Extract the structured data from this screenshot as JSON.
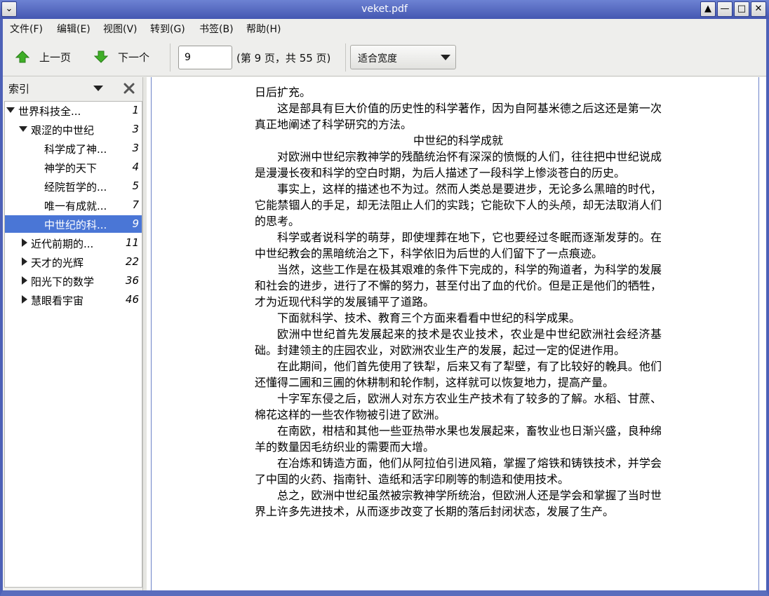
{
  "window": {
    "title": "veket.pdf"
  },
  "menu": [
    "文件(F)",
    "编辑(E)",
    "视图(V)",
    "转到(G)",
    "书签(B)",
    "帮助(H)"
  ],
  "toolbar": {
    "prev_label": "上一页",
    "next_label": "下一个",
    "page_value": "9",
    "page_count": "(第 9 页，共 55 页)",
    "zoom_value": "适合宽度"
  },
  "sidebar": {
    "title": "索引",
    "items": [
      {
        "label": "世界科技全...",
        "page": "1",
        "level": 0,
        "state": "open"
      },
      {
        "label": "艰涩的中世纪",
        "page": "3",
        "level": 1,
        "state": "open"
      },
      {
        "label": "科学成了神...",
        "page": "3",
        "level": 2,
        "state": "leaf"
      },
      {
        "label": "神学的天下",
        "page": "4",
        "level": 2,
        "state": "leaf"
      },
      {
        "label": "经院哲学的...",
        "page": "5",
        "level": 2,
        "state": "leaf"
      },
      {
        "label": "唯一有成就...",
        "page": "7",
        "level": 2,
        "state": "leaf"
      },
      {
        "label": "中世纪的科...",
        "page": "9",
        "level": 2,
        "state": "leaf",
        "selected": true
      },
      {
        "label": "近代前期的...",
        "page": "11",
        "level": 1,
        "state": "closed"
      },
      {
        "label": "天才的光辉",
        "page": "22",
        "level": 1,
        "state": "closed"
      },
      {
        "label": "阳光下的数学",
        "page": "36",
        "level": 1,
        "state": "closed"
      },
      {
        "label": "慧眼看宇宙",
        "page": "46",
        "level": 1,
        "state": "closed"
      }
    ]
  },
  "document": {
    "paragraphs": [
      {
        "text": "日后扩充。",
        "indent": false
      },
      {
        "text": "这是部具有巨大价值的历史性的科学著作，因为自阿基米德之后这还是第一次真正地阐述了科学研究的方法。",
        "indent": true
      },
      {
        "text": "中世纪的科学成就",
        "heading": true
      },
      {
        "text": "对欧洲中世纪宗教神学的残酷统治怀有深深的愤慨的人们，往往把中世纪说成是漫漫长夜和科学的空白时期，为后人描述了一段科学上惨淡苍白的历史。",
        "indent": true
      },
      {
        "text": "事实上，这样的描述也不为过。然而人类总是要进步，无论多么黑暗的时代，它能禁锢人的手足，却无法阻止人们的实践；它能砍下人的头颅，却无法取消人们的思考。",
        "indent": true
      },
      {
        "text": "科学或者说科学的萌芽，即使埋葬在地下，它也要经过冬眠而逐渐发芽的。在中世纪教会的黑暗统治之下，科学依旧为后世的人们留下了一点痕迹。",
        "indent": true
      },
      {
        "text": "当然，这些工作是在极其艰难的条件下完成的，科学的殉道者，为科学的发展和社会的进步，进行了不懈的努力，甚至付出了血的代价。但是正是他们的牺牲，才为近现代科学的发展铺平了道路。",
        "indent": true
      },
      {
        "text": "下面就科学、技术、教育三个方面来看看中世纪的科学成果。",
        "indent": true
      },
      {
        "text": "欧洲中世纪首先发展起来的技术是农业技术，农业是中世纪欧洲社会经济基础。封建领主的庄园农业，对欧洲农业生产的发展，起过一定的促进作用。",
        "indent": true
      },
      {
        "text": "在此期间，他们首先使用了铁犁，后来又有了犁壁，有了比较好的輓具。他们还懂得二圃和三圃的休耕制和轮作制，这样就可以恢复地力，提高产量。",
        "indent": true
      },
      {
        "text": "十字军东侵之后，欧洲人对东方农业生产技术有了较多的了解。水稻、甘蔗、棉花这样的一些农作物被引进了欧洲。",
        "indent": true
      },
      {
        "text": "在南欧，柑桔和其他一些亚热带水果也发展起来，畜牧业也日渐兴盛，良种绵羊的数量因毛纺织业的需要而大增。",
        "indent": true
      },
      {
        "text": "在冶炼和铸造方面，他们从阿拉伯引进风箱，掌握了熔铁和铸铁技术，并学会了中国的火药、指南针、造纸和活字印刷等的制造和使用技术。",
        "indent": true
      },
      {
        "text": "总之，欧洲中世纪虽然被宗教神学所统治，但欧洲人还是学会和掌握了当时世界上许多先进技术，从而逐步改变了长期的落后封闭状态，发展了生产。",
        "indent": true
      }
    ]
  },
  "colors": {
    "titlebar": "#4d61b7",
    "selection": "#4a76d6",
    "arrow_up": "#3fae27",
    "arrow_down": "#3fae27"
  }
}
